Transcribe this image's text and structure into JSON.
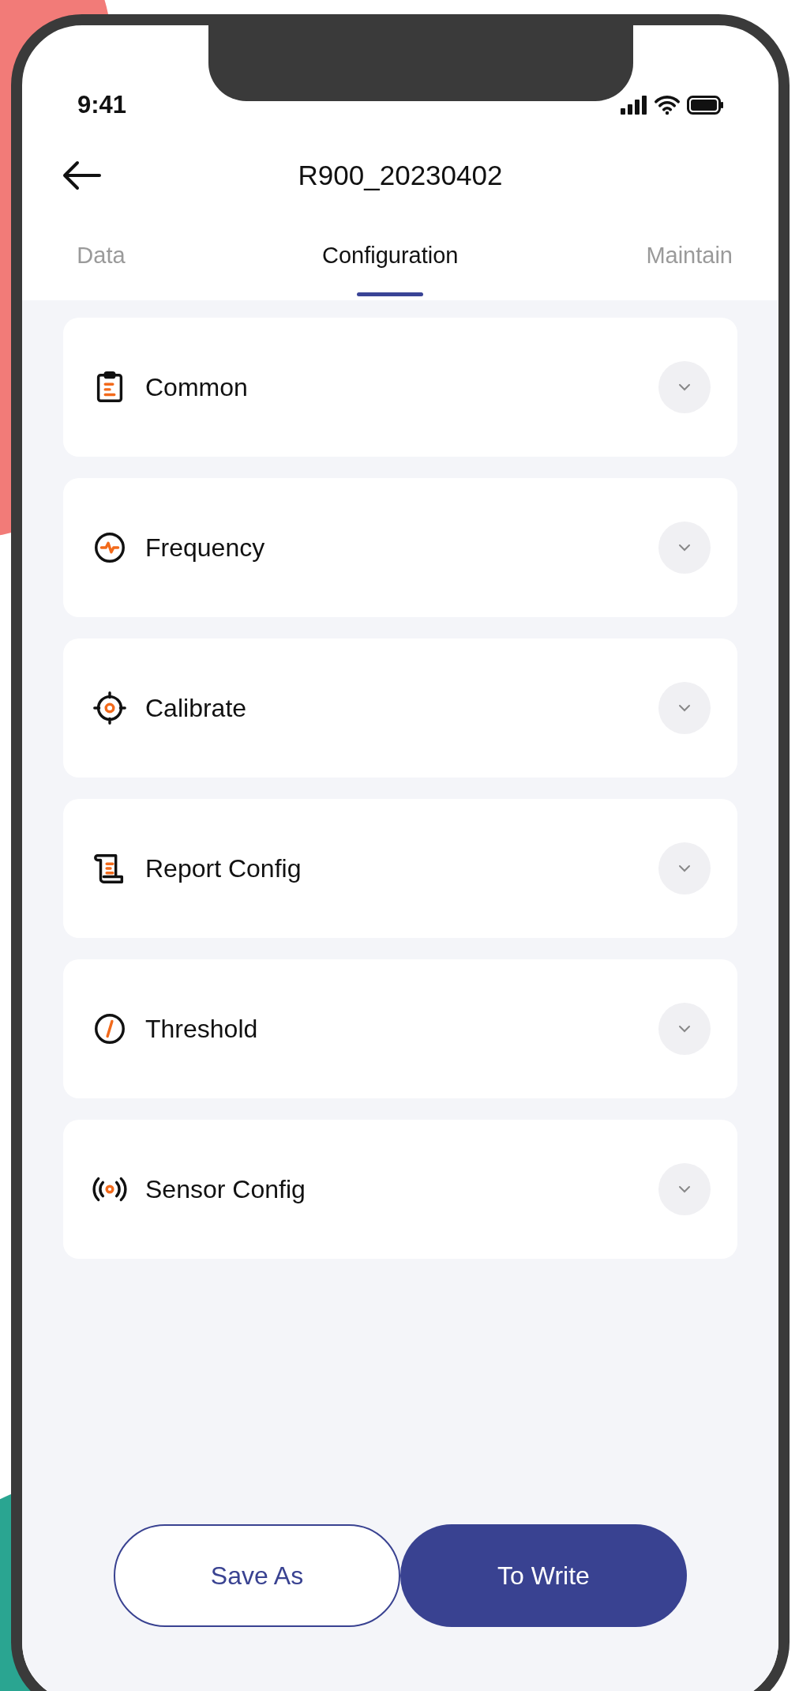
{
  "status_bar": {
    "time": "9:41"
  },
  "header": {
    "title": "R900_20230402"
  },
  "tabs": [
    {
      "label": "Data",
      "selected": false
    },
    {
      "label": "Configuration",
      "selected": true
    },
    {
      "label": "Maintain",
      "selected": false
    }
  ],
  "sections": [
    {
      "label": "Common",
      "expanded": false
    },
    {
      "label": "Frequency",
      "expanded": false
    },
    {
      "label": "Calibrate",
      "expanded": false
    },
    {
      "label": "Report Config",
      "expanded": false
    },
    {
      "label": "Threshold",
      "expanded": false
    },
    {
      "label": "Sensor Config",
      "expanded": false
    }
  ],
  "buttons": [
    {
      "label": "Save As",
      "kind": "outline"
    },
    {
      "label": "To Write",
      "kind": "filled"
    }
  ]
}
